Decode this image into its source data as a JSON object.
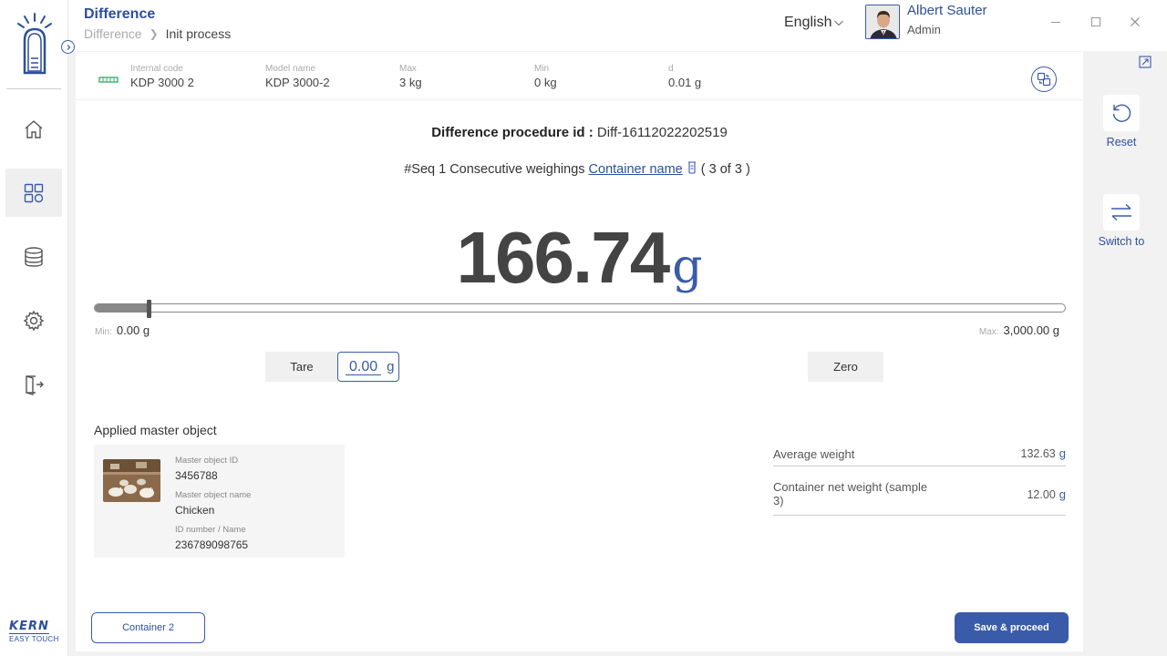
{
  "header": {
    "title": "Difference",
    "breadcrumb_prev": "Difference",
    "breadcrumb_current": "Init process",
    "language": "English",
    "user_name": "Albert Sauter",
    "user_role": "Admin"
  },
  "brand": {
    "logo_name": "KERN",
    "logo_sub": "EASY TOUCH",
    "accent_color": "#3a5ba9"
  },
  "sidebar": {
    "items": [
      {
        "icon": "home-icon",
        "active": false
      },
      {
        "icon": "dashboard-icon",
        "active": true
      },
      {
        "icon": "database-icon",
        "active": false
      },
      {
        "icon": "gear-icon",
        "active": false
      },
      {
        "icon": "logout-icon",
        "active": false
      }
    ]
  },
  "scale_info": {
    "internal_code_label": "Internal code",
    "internal_code": "KDP 3000 2",
    "model_name_label": "Model name",
    "model_name": "KDP 3000-2",
    "max_label": "Max",
    "max": "3 kg",
    "min_label": "Min",
    "min": "0 kg",
    "d_label": "d",
    "d": "0.01 g"
  },
  "procedure": {
    "id_label": "Difference procedure id :",
    "id_value": "Diff-16112022202519",
    "seq_text": "#Seq 1 Consecutive weighings",
    "container_link": "Container name",
    "seq_count": "( 3 of 3 )"
  },
  "weighing": {
    "value": "166.74",
    "unit": "g",
    "level_fraction": 0.0556,
    "min_caption": "Min:",
    "min_value": "0.00 g",
    "max_caption": "Max:",
    "max_value": "3,000.00 g",
    "tare_label": "Tare",
    "tare_value": "0.00",
    "tare_unit": "g",
    "zero_label": "Zero"
  },
  "master": {
    "section_title": "Applied master object",
    "id_label": "Master object ID",
    "id_value": "3456788",
    "name_label": "Master object name",
    "name_value": "Chicken",
    "number_label": "ID number / Name",
    "number_value": "236789098765"
  },
  "stats": {
    "avg_label": "Average weight",
    "avg_value": "132.63",
    "avg_unit": "g",
    "container_label": "Container net weight (sample 3)",
    "container_value": "12.00",
    "container_unit": "g"
  },
  "footer": {
    "container_button": "Container 2",
    "save_button": "Save & proceed"
  },
  "actions": {
    "reset_label": "Reset",
    "switch_label": "Switch to"
  }
}
